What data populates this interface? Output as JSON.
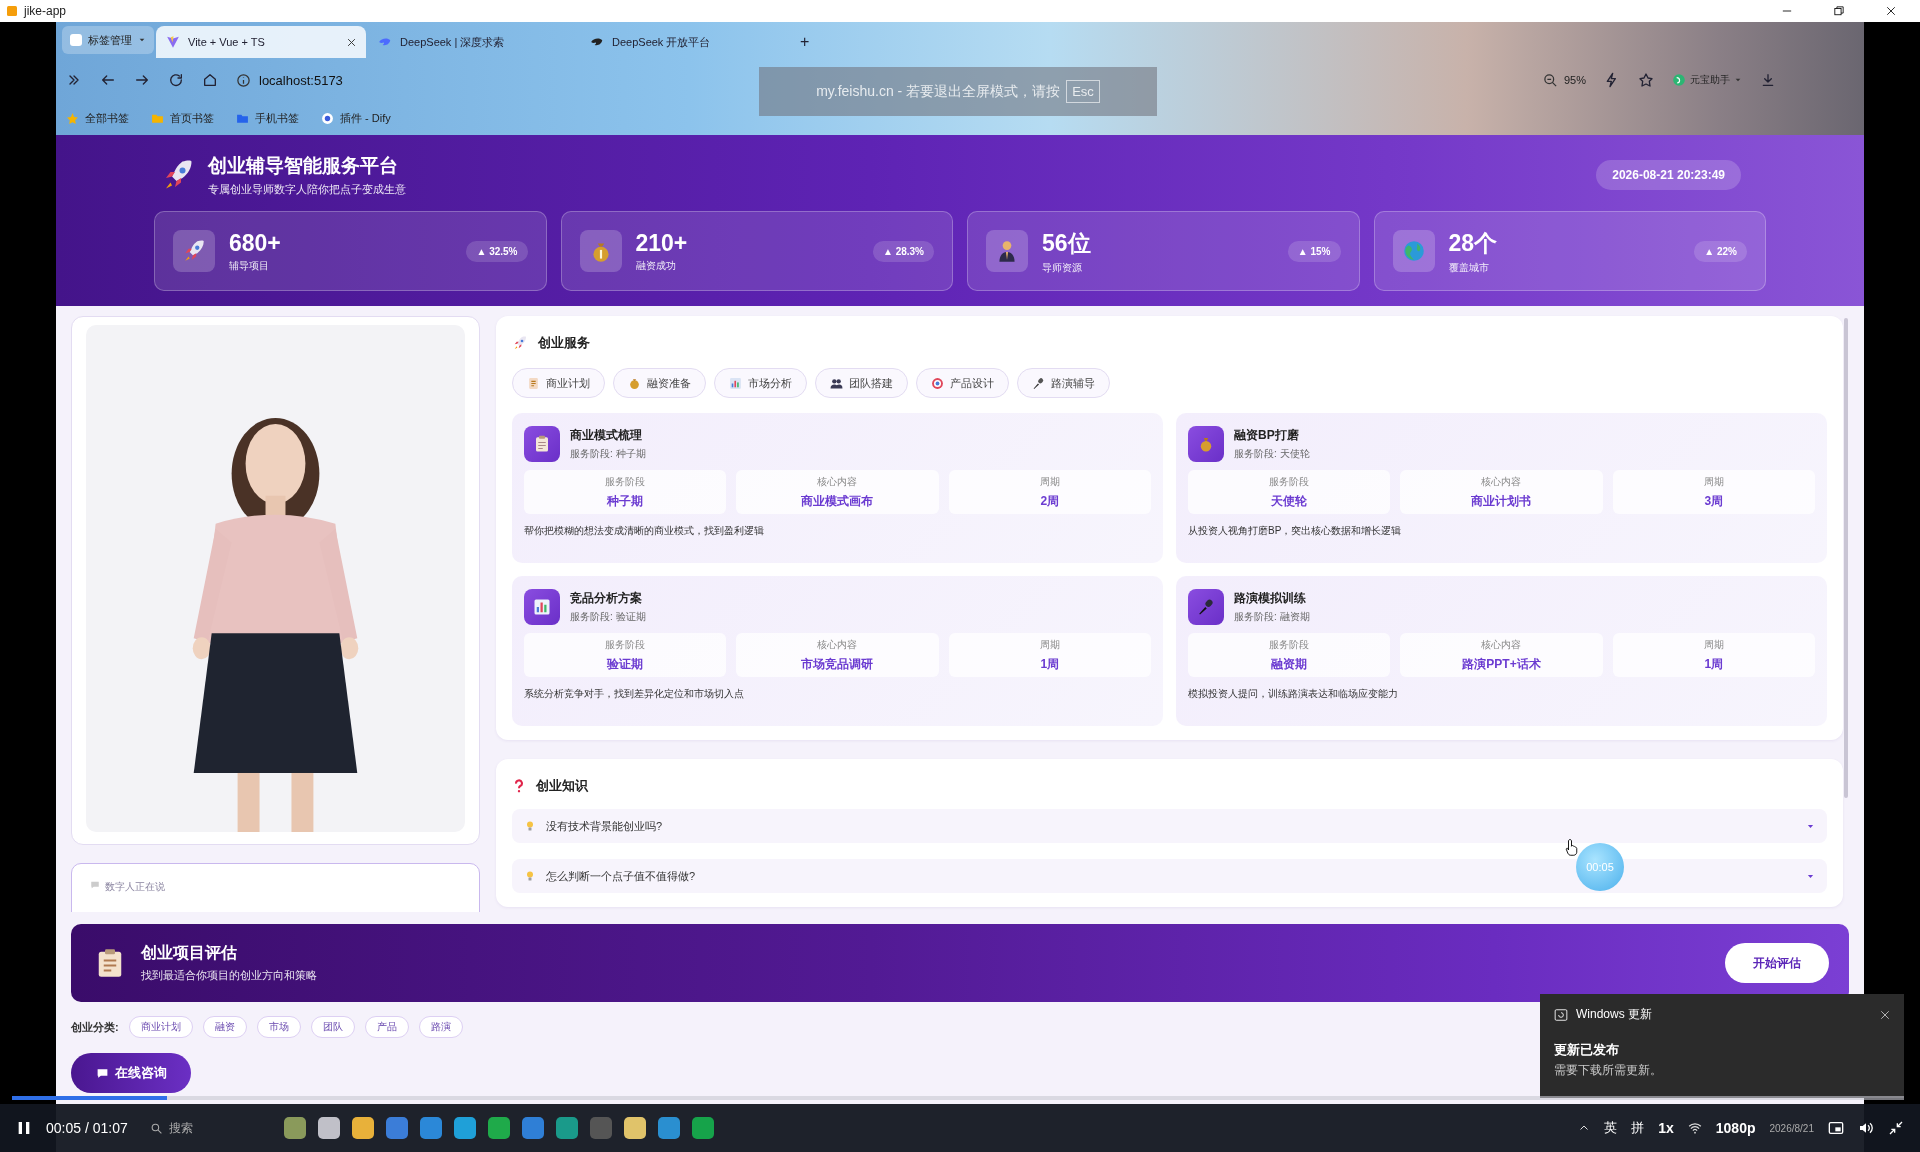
{
  "window": {
    "title": "jike-app"
  },
  "browser": {
    "tab_group": "标签管理",
    "tabs": [
      {
        "label": "Vite + Vue + TS",
        "selected": true
      },
      {
        "label": "DeepSeek | 深度求索",
        "selected": false
      },
      {
        "label": "DeepSeek 开放平台",
        "selected": false
      }
    ],
    "new_tab": "+",
    "url": "localhost:5173",
    "zoom": "95%",
    "extension": "元宝助手",
    "bookmarks": [
      "全部书签",
      "首页书签",
      "手机书签",
      "插件 - Dify"
    ],
    "fullscreen_hint": {
      "text": "my.feishu.cn - 若要退出全屏模式，请按",
      "key": "Esc"
    }
  },
  "app": {
    "header": {
      "title": "创业辅导智能服务平台",
      "subtitle": "专属创业导师数字人陪你把点子变成生意",
      "datetime": "2026-08-21 20:23:49"
    },
    "stats": [
      {
        "value": "680+",
        "label": "辅导项目",
        "trend": "▲ 32.5%"
      },
      {
        "value": "210+",
        "label": "融资成功",
        "trend": "▲ 28.3%"
      },
      {
        "value": "56位",
        "label": "导师资源",
        "trend": "▲ 15%"
      },
      {
        "value": "28个",
        "label": "覆盖城市",
        "trend": "▲ 22%"
      }
    ],
    "avatar": {
      "kind": "picture",
      "speech_status": "数字人正在说"
    },
    "services": {
      "title": "创业服务",
      "chips": [
        "商业计划",
        "融资准备",
        "市场分析",
        "团队搭建",
        "产品设计",
        "路演辅导"
      ],
      "cards": [
        {
          "title": "商业模式梳理",
          "stage": "服务阶段: 种子期",
          "fields": [
            {
              "label": "服务阶段",
              "value": "种子期"
            },
            {
              "label": "核心内容",
              "value": "商业模式画布"
            },
            {
              "label": "周期",
              "value": "2周"
            }
          ],
          "description": "帮你把模糊的想法变成清晰的商业模式，找到盈利逻辑"
        },
        {
          "title": "融资BP打磨",
          "stage": "服务阶段: 天使轮",
          "fields": [
            {
              "label": "服务阶段",
              "value": "天使轮"
            },
            {
              "label": "核心内容",
              "value": "商业计划书"
            },
            {
              "label": "周期",
              "value": "3周"
            }
          ],
          "description": "从投资人视角打磨BP，突出核心数据和增长逻辑"
        },
        {
          "title": "竞品分析方案",
          "stage": "服务阶段: 验证期",
          "fields": [
            {
              "label": "服务阶段",
              "value": "验证期"
            },
            {
              "label": "核心内容",
              "value": "市场竞品调研"
            },
            {
              "label": "周期",
              "value": "1周"
            }
          ],
          "description": "系统分析竞争对手，找到差异化定位和市场切入点"
        },
        {
          "title": "路演模拟训练",
          "stage": "服务阶段: 融资期",
          "fields": [
            {
              "label": "服务阶段",
              "value": "融资期"
            },
            {
              "label": "核心内容",
              "value": "路演PPT+话术"
            },
            {
              "label": "周期",
              "value": "1周"
            }
          ],
          "description": "模拟投资人提问，训练路演表达和临场应变能力"
        }
      ]
    },
    "knowledge": {
      "title": "创业知识",
      "faqs": [
        {
          "question": "没有技术背景能创业吗?",
          "expanded": false
        },
        {
          "question": "怎么判断一个点子值不值得做?",
          "expanded": false
        }
      ]
    },
    "evaluation": {
      "title": "创业项目评估",
      "subtitle": "找到最适合你项目的创业方向和策略",
      "button": "开始评估"
    },
    "categories": {
      "label": "创业分类:",
      "tags": [
        "商业计划",
        "融资",
        "市场",
        "团队",
        "产品",
        "路演"
      ]
    },
    "consult_button": "在线咨询"
  },
  "video": {
    "progress": {
      "level": 0.082
    },
    "time": "00:05 / 01:07",
    "timer": "00:05",
    "speed": "1x",
    "quality": "1080p"
  },
  "taskbar": {
    "search": "搜索",
    "input_method": "英",
    "ime": "拼",
    "date": "2026/8/21"
  },
  "toast": {
    "app": "Windows 更新",
    "title": "更新已发布",
    "body": "需要下载所需更新。"
  }
}
